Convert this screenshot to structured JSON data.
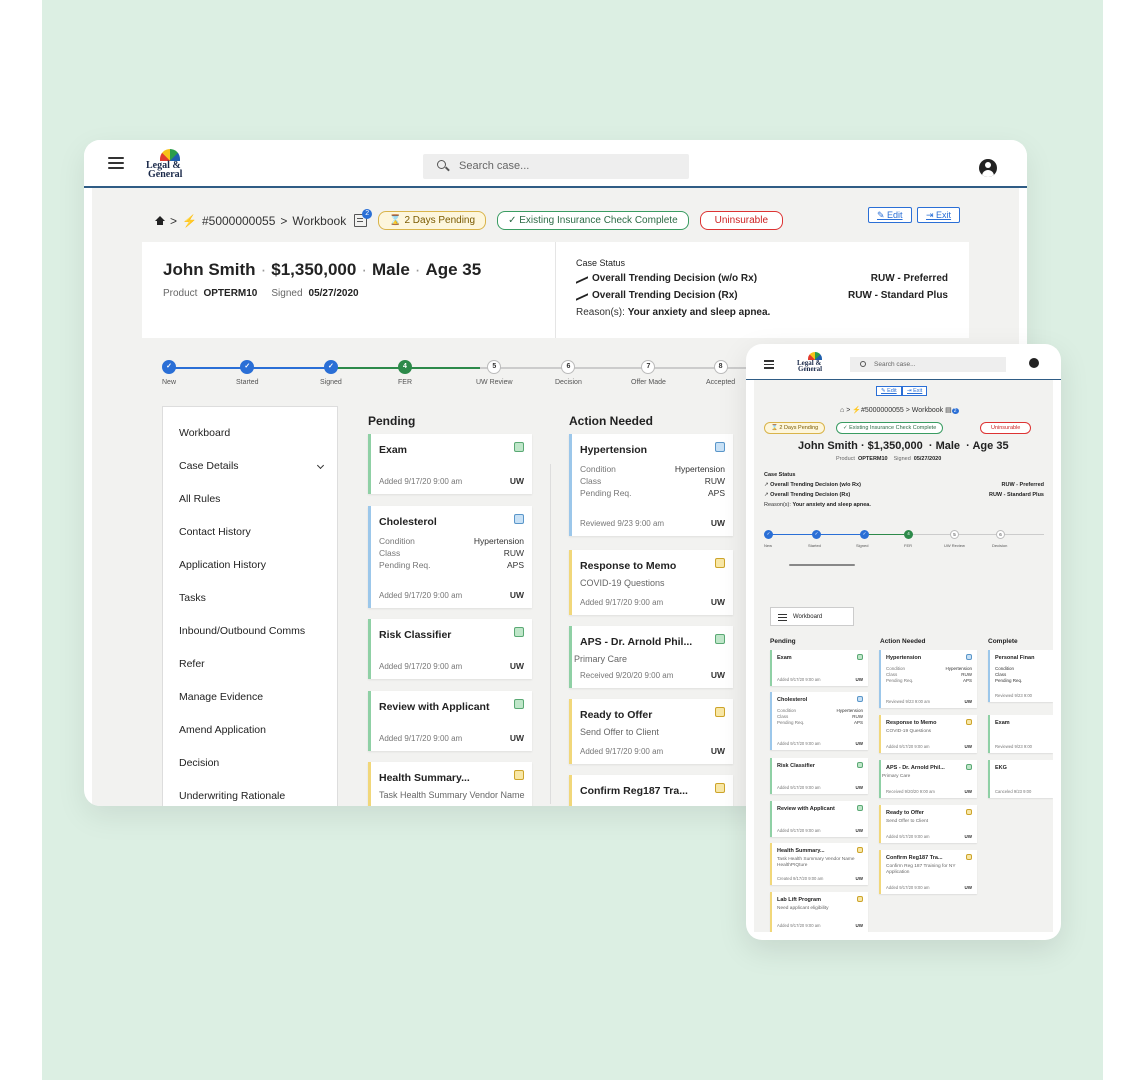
{
  "brand": {
    "line1": "Legal &",
    "line2": "General"
  },
  "search": {
    "placeholder": "Search case..."
  },
  "breadcrumb": {
    "case_id": "#5000000055",
    "sep": ">",
    "page": "Workbook",
    "notif_count": "2"
  },
  "chips": {
    "pending": "⌛ 2 Days Pending",
    "check": "✓ Existing Insurance Check Complete",
    "uninsurable": "Uninsurable"
  },
  "actions": {
    "edit": "✎ Edit",
    "exit": "⇥ Exit"
  },
  "summary": {
    "name": "John Smith",
    "amount": "$1,350,000",
    "gender": "Male",
    "age": "Age 35",
    "product_label": "Product",
    "product": "OPTERM10",
    "signed_label": "Signed",
    "signed": "05/27/2020",
    "case_status_label": "Case Status",
    "decision_wo_rx_label": "Overall Trending Decision (w/o Rx)",
    "decision_wo_rx": "RUW - Preferred",
    "decision_rx_label": "Overall Trending Decision (Rx)",
    "decision_rx": "RUW - Standard Plus",
    "reason_label": "Reason(s):",
    "reason": "Your anxiety and sleep apnea."
  },
  "steps": [
    {
      "num": "✓",
      "label": "New",
      "state": "done"
    },
    {
      "num": "✓",
      "label": "Started",
      "state": "done"
    },
    {
      "num": "✓",
      "label": "Signed",
      "state": "done"
    },
    {
      "num": "4",
      "label": "FER",
      "state": "current"
    },
    {
      "num": "5",
      "label": "UW Review",
      "state": "todo"
    },
    {
      "num": "6",
      "label": "Decision",
      "state": "todo"
    },
    {
      "num": "7",
      "label": "Offer Made",
      "state": "todo"
    },
    {
      "num": "8",
      "label": "Accepted",
      "state": "todo"
    }
  ],
  "sidebar": {
    "items": [
      "Workboard",
      "Case Details",
      "All Rules",
      "Contact History",
      "Application History",
      "Tasks",
      "Inbound/Outbound Comms",
      "Refer",
      "Manage Evidence",
      "Amend Application",
      "Decision",
      "Underwriting Rationale"
    ]
  },
  "columns": {
    "pending": "Pending",
    "action": "Action Needed",
    "complete": "Complete"
  },
  "pending_cards": [
    {
      "title": "Exam",
      "footer": "Added 9/17/20 9:00 am",
      "who": "UW"
    },
    {
      "title": "Cholesterol",
      "k1": "Condition",
      "v1": "Hypertension",
      "k2": "Class",
      "v2": "RUW",
      "k3": "Pending Req.",
      "v3": "APS",
      "footer": "Added 9/17/20 9:00 am",
      "who": "UW"
    },
    {
      "title": "Risk Classifier",
      "footer": "Added 9/17/20 9:00 am",
      "who": "UW"
    },
    {
      "title": "Review with Applicant",
      "footer": "Added 9/17/20 9:00 am",
      "who": "UW"
    },
    {
      "title": "Health Summary...",
      "sub": "Task Health Summary Vendor Name",
      "sub2": "HealthPIQture",
      "footer": "Created 9/17/20 9:00 am",
      "who": "UW"
    },
    {
      "title": "Lab Lift Program",
      "sub": "Need applicant eligibility",
      "footer": "Added 9/17/20 9:00 am",
      "who": "UW"
    }
  ],
  "action_cards": [
    {
      "title": "Hypertension",
      "k1": "Condition",
      "v1": "Hypertension",
      "k2": "Class",
      "v2": "RUW",
      "k3": "Pending Req.",
      "v3": "APS",
      "footer": "Reviewed 9/23 9:00 am",
      "who": "UW"
    },
    {
      "title": "Response to Memo",
      "sub": "COVID-19 Questions",
      "footer": "Added 9/17/20 9:00 am",
      "who": "UW"
    },
    {
      "title": "APS - Dr. Arnold Phil...",
      "sub": "Primary Care",
      "footer": "Received 9/20/20 9:00 am",
      "who": "UW"
    },
    {
      "title": "Ready to Offer",
      "sub": "Send Offer to Client",
      "footer": "Added 9/17/20 9:00 am",
      "who": "UW"
    },
    {
      "title": "Confirm Reg187 Tra...",
      "sub": "Confirm Reg 187 Training for NY",
      "sub2": "Application",
      "footer": "Added 9/17/20 9:00 am",
      "who": "UW"
    }
  ],
  "complete_cards": [
    {
      "title": "Personal Finan",
      "k1": "Condition",
      "k2": "Class",
      "k3": "Pending Req.",
      "footer": "Reviewed 9/23 9:00"
    },
    {
      "title": "Exam",
      "footer": "Reviewed 9/23 9:00"
    },
    {
      "title": "EKG",
      "footer": "Canceled 9/23 9:00"
    }
  ]
}
